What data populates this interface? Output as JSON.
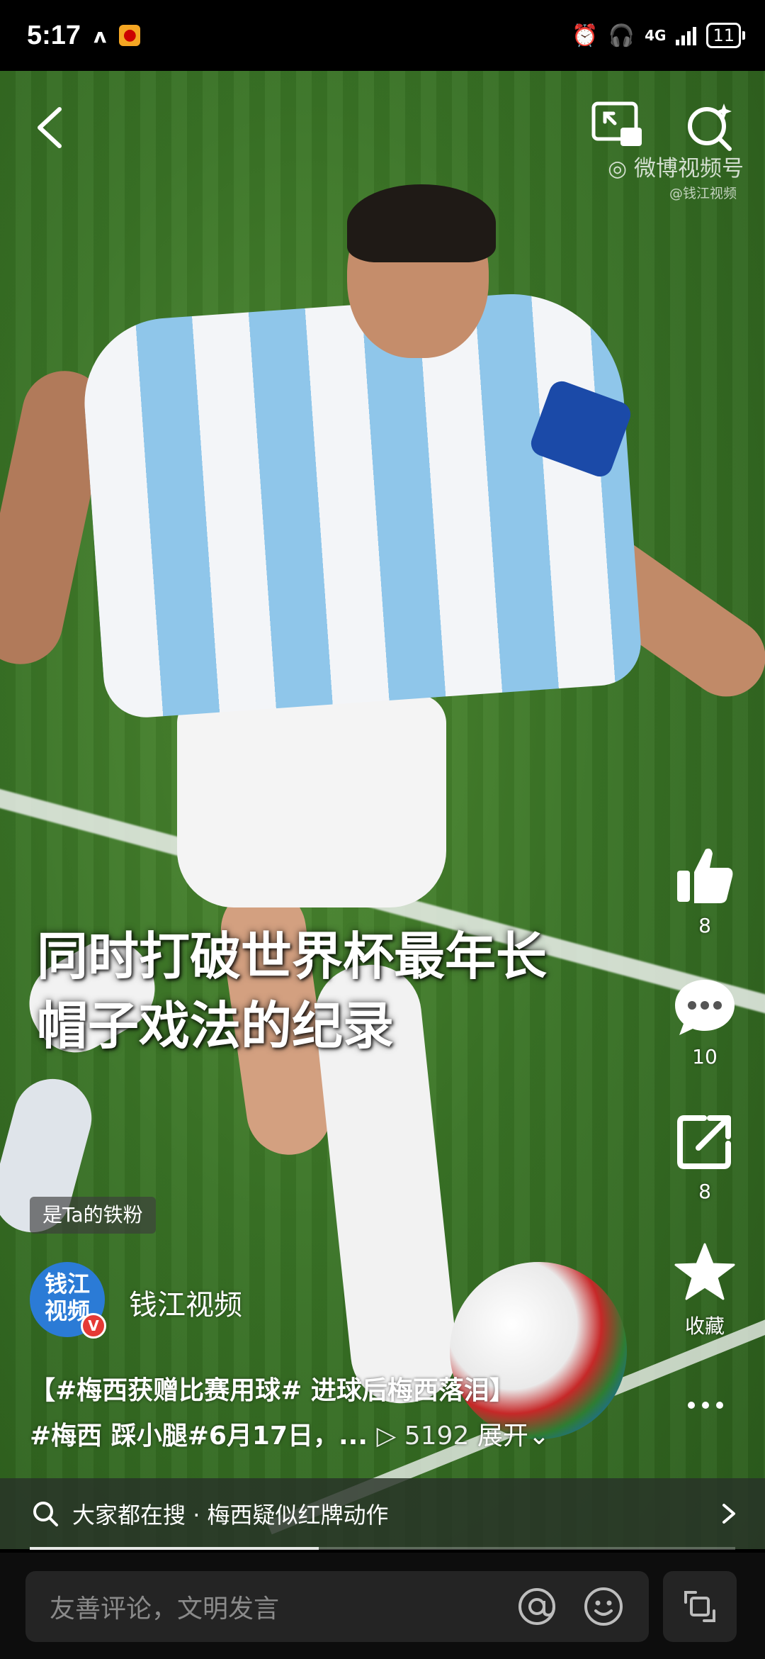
{
  "status_bar": {
    "time": "5:17",
    "network": "4G",
    "battery": "11"
  },
  "video": {
    "watermark": "微博视频号",
    "watermark_sub": "@钱江视频",
    "subtitle_line1": "同时打破世界杯最年长",
    "subtitle_line2": "帽子戏法的纪录",
    "progress": 0.41
  },
  "actions": {
    "like_count": "8",
    "comment_count": "10",
    "share_count": "8",
    "favorite_label": "收藏"
  },
  "author": {
    "fan_badge": "是Ta的铁粉",
    "avatar_text": "钱江视频",
    "name": "钱江视频"
  },
  "caption": {
    "line1": "【#梅西获赠比赛用球# 进球后梅西落泪】",
    "line2_text": "#梅西 踩小腿#6月17日，...",
    "views": "5192",
    "expand": "展开"
  },
  "suggestion": {
    "prefix": "大家都在搜",
    "query": "梅西疑似红牌动作"
  },
  "comment_bar": {
    "placeholder": "友善评论，文明发言"
  },
  "colors": {
    "background": "#000000",
    "pitch": "#3a7426",
    "verified_badge": "#e53935",
    "avatar_bg": "#2b7bd6"
  }
}
